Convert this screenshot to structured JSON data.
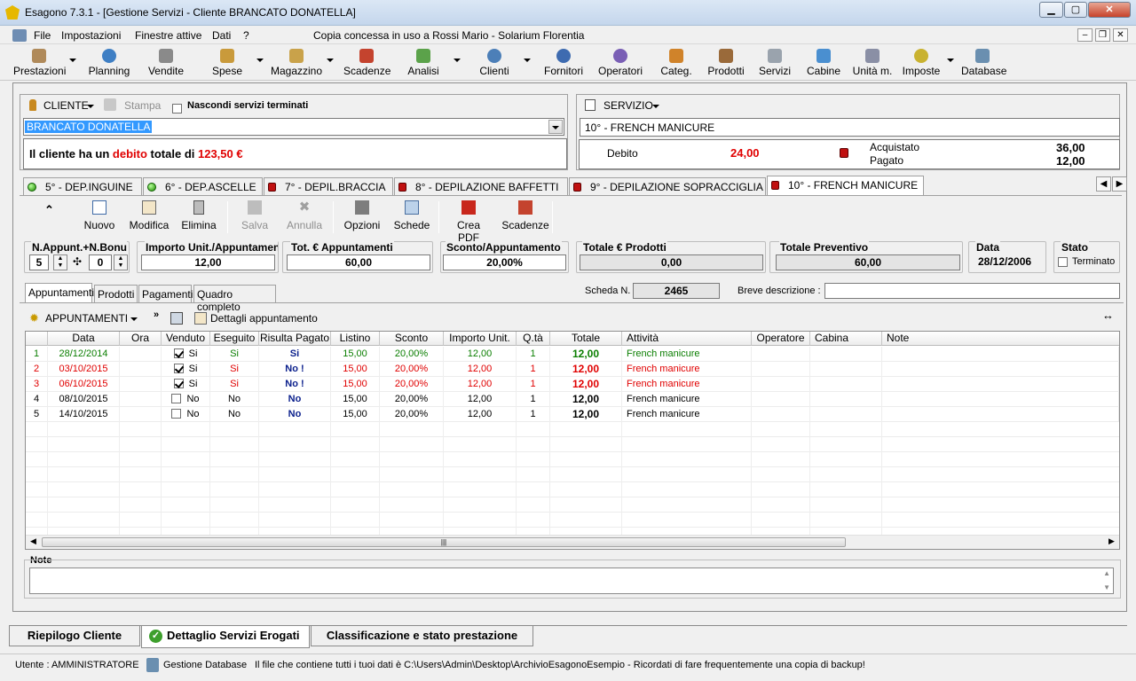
{
  "window": {
    "title": "Esagono 7.3.1 - [Gestione Servizi - Cliente BRANCATO DONATELLA]"
  },
  "menu": {
    "items": [
      "File",
      "Impostazioni",
      "Finestre attive",
      "Dati",
      "?"
    ],
    "license": "Copia concessa in uso a Rossi Mario - Solarium Florentia"
  },
  "toolbar": {
    "items": [
      "Prestazioni",
      "Planning",
      "Vendite",
      "Spese",
      "Magazzino",
      "Scadenze",
      "Analisi",
      "Clienti",
      "Fornitori",
      "Operatori",
      "Categ.",
      "Prodotti",
      "Servizi",
      "Cabine",
      "Unità m.",
      "Imposte",
      "Database"
    ]
  },
  "cliente": {
    "label": "CLIENTE",
    "stampa": "Stampa",
    "nascondi": "Nascondi servizi terminati",
    "name": "BRANCATO DONATELLA",
    "debito_prefix": "Il cliente ha un ",
    "debito_word": "debito",
    "debito_middle": " totale di ",
    "debito_amount": "123,50 €"
  },
  "servizio": {
    "label": "SERVIZIO",
    "name": "10° - FRENCH MANICURE",
    "debito_label": "Debito",
    "debito_value": "24,00",
    "acquistato_label": "Acquistato",
    "acquistato_value": "36,00",
    "pagato_label": "Pagato",
    "pagato_value": "12,00"
  },
  "service_tabs": [
    {
      "label": "5° - DEP.INGUINE",
      "status": "green"
    },
    {
      "label": "6° - DEP.ASCELLE",
      "status": "green"
    },
    {
      "label": "7° - DEPIL.BRACCIA",
      "status": "red"
    },
    {
      "label": "8° - DEPILAZIONE BAFFETTI",
      "status": "red"
    },
    {
      "label": "9° - DEPILAZIONE SOPRACCIGLIA",
      "status": "red"
    },
    {
      "label": "10° - FRENCH MANICURE",
      "status": "red"
    }
  ],
  "actions": {
    "nuovo": "Nuovo",
    "modifica": "Modifica",
    "elimina": "Elimina",
    "salva": "Salva",
    "annulla": "Annulla",
    "opzioni": "Opzioni",
    "schede": "Schede",
    "crea_pdf": "Crea PDF",
    "scadenze": "Scadenze"
  },
  "fields": {
    "nappunt_label": "N.Appunt.+N.Bonus",
    "nappunt": "5",
    "nbonus": "0",
    "importo_label": "Importo Unit./Appuntamento",
    "importo": "12,00",
    "tot_label": "Tot. € Appuntamenti",
    "tot": "60,00",
    "sconto_label": "Sconto/Appuntamento",
    "sconto": "20,00%",
    "totprod_label": "Totale € Prodotti",
    "totprod": "0,00",
    "totprev_label": "Totale Preventivo",
    "totprev": "60,00",
    "data_label": "Data",
    "data": "28/12/2006",
    "stato_label": "Stato",
    "terminato": "Terminato"
  },
  "subtabs": [
    "Appuntamenti",
    "Prodotti",
    "Pagamenti",
    "Quadro completo"
  ],
  "scheda": {
    "label": "Scheda N.",
    "value": "2465",
    "breve_label": "Breve descrizione :"
  },
  "appuntamenti": {
    "label": "APPUNTAMENTI",
    "dettagli": "Dettagli appuntamento"
  },
  "grid": {
    "columns": [
      "Data",
      "Ora",
      "Venduto",
      "Eseguito",
      "Risulta Pagato",
      "Listino",
      "Sconto",
      "Importo Unit.",
      "Q.tà",
      "Totale",
      "Attività",
      "Operatore",
      "Cabina",
      "Note"
    ],
    "rows": [
      {
        "n": "1",
        "data": "28/12/2014",
        "ora": "",
        "venduto": true,
        "venduto_txt": "Si",
        "eseguito": "Si",
        "pagato": "Si",
        "listino": "15,00",
        "sconto": "20,00%",
        "importo": "12,00",
        "qta": "1",
        "totale": "12,00",
        "attivita": "French manicure",
        "color": "green"
      },
      {
        "n": "2",
        "data": "03/10/2015",
        "ora": "",
        "venduto": true,
        "venduto_txt": "Si",
        "eseguito": "Si",
        "pagato": "No !",
        "listino": "15,00",
        "sconto": "20,00%",
        "importo": "12,00",
        "qta": "1",
        "totale": "12,00",
        "attivita": "French manicure",
        "color": "red"
      },
      {
        "n": "3",
        "data": "06/10/2015",
        "ora": "",
        "venduto": true,
        "venduto_txt": "Si",
        "eseguito": "Si",
        "pagato": "No !",
        "listino": "15,00",
        "sconto": "20,00%",
        "importo": "12,00",
        "qta": "1",
        "totale": "12,00",
        "attivita": "French manicure",
        "color": "red"
      },
      {
        "n": "4",
        "data": "08/10/2015",
        "ora": "",
        "venduto": false,
        "venduto_txt": "No",
        "eseguito": "No",
        "pagato": "No",
        "listino": "15,00",
        "sconto": "20,00%",
        "importo": "12,00",
        "qta": "1",
        "totale": "12,00",
        "attivita": "French manicure",
        "color": "black"
      },
      {
        "n": "5",
        "data": "14/10/2015",
        "ora": "",
        "venduto": false,
        "venduto_txt": "No",
        "eseguito": "No",
        "pagato": "No",
        "listino": "15,00",
        "sconto": "20,00%",
        "importo": "12,00",
        "qta": "1",
        "totale": "12,00",
        "attivita": "French manicure",
        "color": "black"
      }
    ]
  },
  "note": {
    "label": "Note"
  },
  "bottom_tabs": [
    "Riepilogo Cliente",
    "Dettaglio Servizi Erogati",
    "Classificazione e stato prestazione"
  ],
  "status": {
    "utente": "Utente : AMMINISTRATORE",
    "gestione": "Gestione Database",
    "message": "Il file che contiene tutti i tuoi dati è C:\\Users\\Admin\\Desktop\\ArchivioEsagonoEsempio - Ricordati di fare frequentemente una copia di backup!"
  },
  "colors": {
    "red": "#e00000",
    "green": "#0a7e00",
    "navy": "#0a1f8c",
    "selection": "#3399ff"
  }
}
